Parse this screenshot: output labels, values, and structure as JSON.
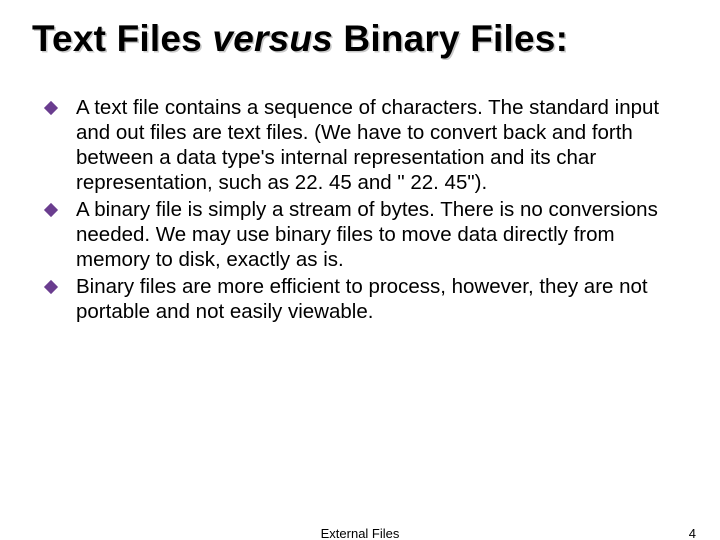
{
  "title": {
    "pre": "Text Files ",
    "italic": "versus",
    "post": " Binary Files:"
  },
  "bullets": [
    " A text file contains a sequence of characters. The standard input and out files are text files. (We have to convert back and forth between a data type's internal representation and its char representation, such as 22. 45 and \" 22. 45\").",
    " A binary file is simply a stream of bytes. There is no conversions needed. We may use binary files to move data directly from memory to disk, exactly as is.",
    " Binary files are more efficient to process, however, they are not portable and not easily viewable."
  ],
  "footer": {
    "center": "External Files",
    "page": "4"
  }
}
